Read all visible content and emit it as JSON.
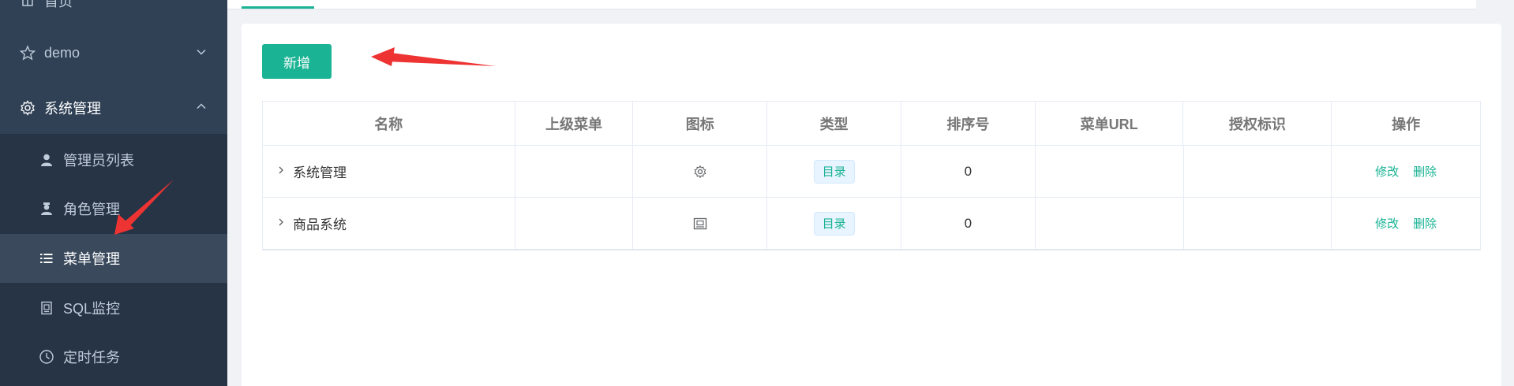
{
  "sidebar": {
    "items": [
      {
        "label": "首页",
        "icon": "home-icon"
      },
      {
        "label": "demo",
        "icon": "star-icon"
      },
      {
        "label": "系统管理",
        "icon": "gear-icon"
      }
    ],
    "sub_items": [
      {
        "label": "管理员列表",
        "icon": "user-icon"
      },
      {
        "label": "角色管理",
        "icon": "role-icon"
      },
      {
        "label": "菜单管理",
        "icon": "list-icon"
      },
      {
        "label": "SQL监控",
        "icon": "monitor-icon"
      },
      {
        "label": "定时任务",
        "icon": "clock-icon"
      }
    ]
  },
  "toolbar": {
    "add_label": "新增"
  },
  "table": {
    "headers": [
      "名称",
      "上级菜单",
      "图标",
      "类型",
      "排序号",
      "菜单URL",
      "授权标识",
      "操作"
    ],
    "rows": [
      {
        "name": "系统管理",
        "parent": "",
        "icon": "gear-icon",
        "type": "目录",
        "sort": "0",
        "url": "",
        "perms": "",
        "edit": "修改",
        "delete": "删除"
      },
      {
        "name": "商品系统",
        "parent": "",
        "icon": "product-icon",
        "type": "目录",
        "sort": "0",
        "url": "",
        "perms": "",
        "edit": "修改",
        "delete": "删除"
      }
    ]
  },
  "colors": {
    "accent": "#1ab394",
    "sidebar_bg": "#304156",
    "annotation": "#ee3333"
  }
}
